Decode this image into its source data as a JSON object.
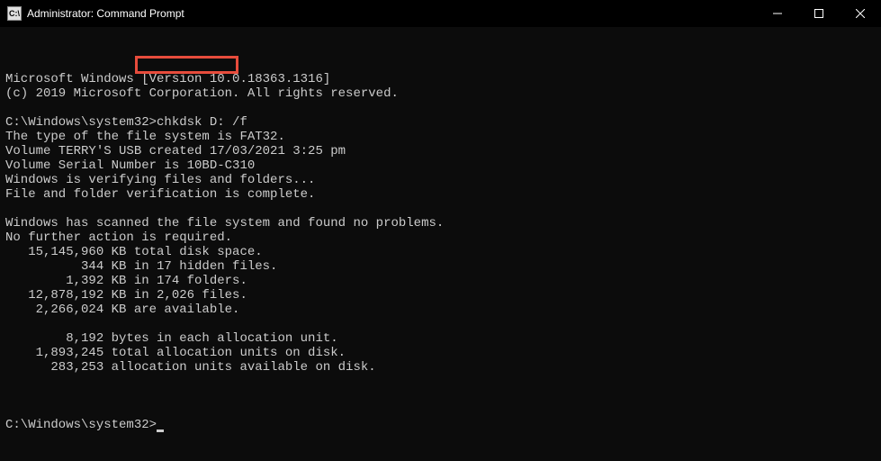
{
  "titlebar": {
    "icon_label": "C:\\",
    "title": "Administrator: Command Prompt"
  },
  "terminal": {
    "lines": [
      "Microsoft Windows [Version 10.0.18363.1316]",
      "(c) 2019 Microsoft Corporation. All rights reserved.",
      "",
      "C:\\Windows\\system32>chkdsk D: /f",
      "The type of the file system is FAT32.",
      "Volume TERRY'S USB created 17/03/2021 3:25 pm",
      "Volume Serial Number is 10BD-C310",
      "Windows is verifying files and folders...",
      "File and folder verification is complete.",
      "",
      "Windows has scanned the file system and found no problems.",
      "No further action is required.",
      "   15,145,960 KB total disk space.",
      "          344 KB in 17 hidden files.",
      "        1,392 KB in 174 folders.",
      "   12,878,192 KB in 2,026 files.",
      "    2,266,024 KB are available.",
      "",
      "        8,192 bytes in each allocation unit.",
      "    1,893,245 total allocation units on disk.",
      "      283,253 allocation units available on disk.",
      ""
    ],
    "prompt": "C:\\Windows\\system32>",
    "highlighted_command": "chkdsk D: /f"
  }
}
